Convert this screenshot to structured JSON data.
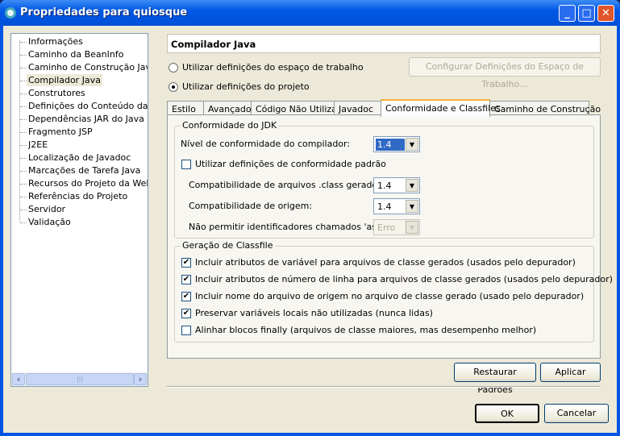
{
  "window": {
    "title": "Propriedades para quiosque"
  },
  "tree": {
    "items": [
      "Informações",
      "Caminho da BeanInfo",
      "Caminho de Construção Java",
      "Compilador Java",
      "Construtores",
      "Definições do Conteúdo da Web",
      "Dependências JAR do Java",
      "Fragmento JSP",
      "J2EE",
      "Localização de Javadoc",
      "Marcações de Tarefa Java",
      "Recursos do Projeto da Web",
      "Referências do Projeto",
      "Servidor",
      "Validação"
    ],
    "selected": "Compilador Java"
  },
  "header": {
    "title": "Compilador Java"
  },
  "radios": {
    "workspace": "Utilizar definições do espaço de trabalho",
    "project": "Utilizar definições do projeto",
    "selected": "project"
  },
  "configure_button": "Configurar Definições do Espaço de Trabalho...",
  "tabs": [
    "Estilo",
    "Avançado",
    "Código Não Utilizado",
    "Javadoc",
    "Conformidade e Classfiles",
    "Caminho de Construção"
  ],
  "active_tab": "Conformidade e Classfiles",
  "jdk": {
    "title": "Conformidade do JDK",
    "compliance_label": "Nível de conformidade do compilador:",
    "compliance_value": "1.4",
    "default_label": "Utilizar definições de conformidade padrão",
    "default_checked": false,
    "classfile_label": "Compatibilidade de arquivos .class gerados:",
    "classfile_value": "1.4",
    "source_label": "Compatibilidade de origem:",
    "source_value": "1.4",
    "assert_label": "Não permitir identificadores chamados 'assert':",
    "assert_value": "Erro"
  },
  "classfile": {
    "title": "Geração de Classfile",
    "options": [
      {
        "label": "Incluir atributos de variável para arquivos de classe gerados (usados pelo depurador)",
        "checked": true
      },
      {
        "label": "Incluir atributos de número de linha para arquivos de classe gerados (usados pelo depurador)",
        "checked": true
      },
      {
        "label": "Incluir nome do arquivo de origem no arquivo de classe gerado (usado pelo depurador)",
        "checked": true
      },
      {
        "label": "Preservar variáveis locais não utilizadas (nunca lidas)",
        "checked": true
      },
      {
        "label": "Alinhar blocos finally (arquivos de classe maiores, mas desempenho melhor)",
        "checked": false
      }
    ]
  },
  "buttons": {
    "restore": "Restaurar Padrões",
    "apply": "Aplicar",
    "ok": "OK",
    "cancel": "Cancelar"
  },
  "glyphs": {
    "check": "✔",
    "arrow": "▼",
    "left": "‹",
    "right": "›",
    "min": "_",
    "max": "□",
    "close": "✕"
  }
}
